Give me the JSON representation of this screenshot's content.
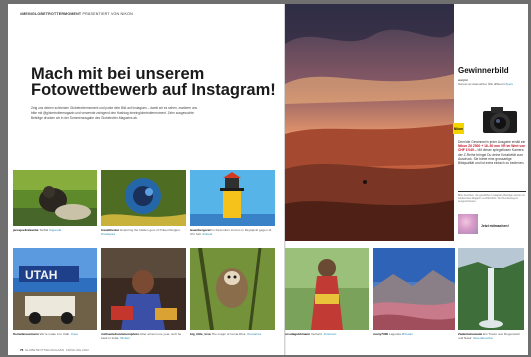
{
  "header": {
    "kicker_bold": "#MEINGLOBETROTTERMOMENT",
    "kicker_rest": " PRÄSENTIERT VON NIKON"
  },
  "article": {
    "headline": "Mach mit bei unserem Fotowettbewerb auf Instagram!",
    "intro": "Zeig uns deinen schönsten Globetrottermoment und poste dein Bild auf Instagram – damit wir es sehen, markiere uns bitte mit @globetrottermagazin und verwende zwingend den Hashtag #meinglobetrottermoment. Zehn ausgesuchte Beiträge drucken wir in der Sommerausgabe des Globetrotter-Magazins ab."
  },
  "posts": [
    {
      "user": "jarosjeeltrekantie",
      "text": "Teriflal",
      "tag": "#uganda"
    },
    {
      "user": "travelthedoc",
      "text": "Exploring the hidden gem of Pulau Pangkor.",
      "tag": "#malaysia"
    },
    {
      "user": "leuenbergoral",
      "text": "Im Dezember sind es in Reykjavík gegen 11 Uhr hell.",
      "tag": "#island"
    },
    {
      "user": "floriankreuzmann",
      "text": "We're make it to Utah.",
      "tag": "#usa"
    },
    {
      "user": "michaelsdreammemphoto",
      "text": "After almost one year, we'll be back in India.",
      "tag": "#indien"
    },
    {
      "user": "big_little_lova",
      "text": "The magic of Costa Rica.",
      "tag": "#costarica"
    },
    {
      "user": "ursulagubhmann",
      "text": "Verharrt.",
      "tag": "#vietnam"
    },
    {
      "user": "mony7330",
      "text": "Lagunita",
      "tag": "#bhutan"
    },
    {
      "user": "Zadentalouzaule",
      "text": "Ein Traum aus Regenwald und Natur.",
      "tag": "#suedamerika"
    }
  ],
  "sidebar": {
    "title": "Gewinnerbild",
    "winner_user": "warjint",
    "winner_text": "Sonnet at Hoarushine hills different",
    "winner_tag": "#peru",
    "brand": "Nikon",
    "prize_lead": "Dem/die Gewinner/in jeder Ausgabe erhält ein",
    "prize_product": "Nikon Z6 Z500 + 16–50 mm VR im Wert von CHF 1'049.–",
    "prize_rest": "Mit dieser spiegellosen Kamera der Z-Reihe bringst Du deine Kreativität zum Ausdruck. Sie bietet eine grossartige Bildqualität und ist extra einfach zu bedienen.",
    "disclaimer": "Bitte beachten: die gewählten Instagram-Beiträge werden im Globetrotter-Magazin veröffentlicht. Der Rechtsweg ist ausgeschlossen.",
    "join": "Jetzt mitmachen!"
  },
  "footer": {
    "page": "76",
    "pub": "GLOBETROTTER-MAGAZIN",
    "season": "FRÜHLING 2023"
  }
}
